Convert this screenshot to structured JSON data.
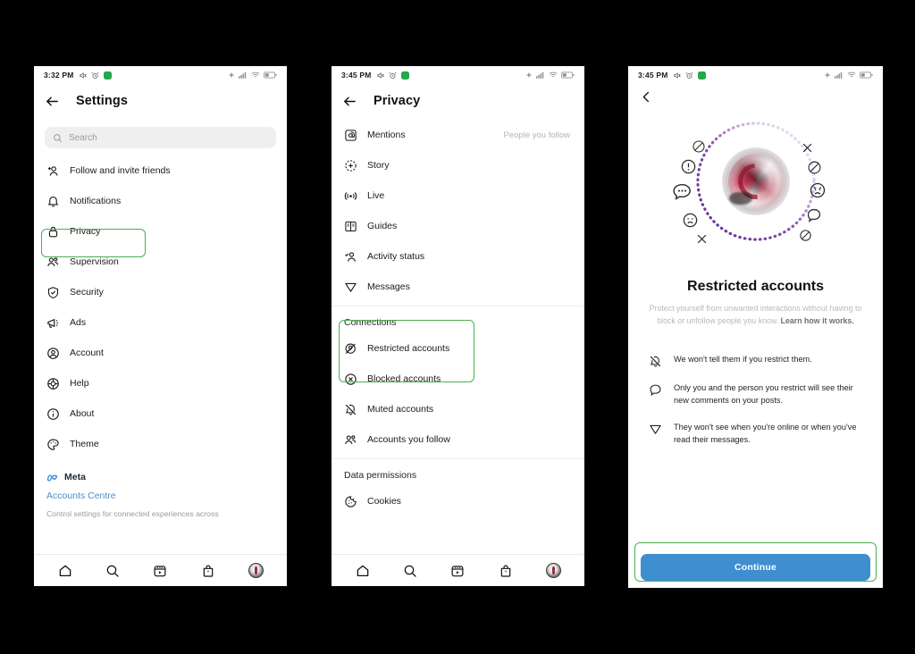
{
  "phones": [
    {
      "id": "settings",
      "status": {
        "time": "3:32 PM",
        "icons": [
          "mute-icon",
          "alarm-icon",
          "green-badge-icon",
          "location-icon",
          "signal-icon",
          "wifi-icon",
          "battery-icon"
        ]
      },
      "header": {
        "back": "back-arrow-icon",
        "title": "Settings"
      },
      "search": {
        "placeholder": "Search",
        "icon": "search-icon"
      },
      "items": [
        {
          "label": "Follow and invite friends",
          "icon": "add-person-icon"
        },
        {
          "label": "Notifications",
          "icon": "bell-icon"
        },
        {
          "label": "Privacy",
          "icon": "lock-icon",
          "highlighted": true
        },
        {
          "label": "Supervision",
          "icon": "people-icon"
        },
        {
          "label": "Security",
          "icon": "shield-check-icon"
        },
        {
          "label": "Ads",
          "icon": "megaphone-icon"
        },
        {
          "label": "Account",
          "icon": "account-circle-icon"
        },
        {
          "label": "Help",
          "icon": "lifebuoy-icon"
        },
        {
          "label": "About",
          "icon": "info-circle-icon"
        },
        {
          "label": "Theme",
          "icon": "palette-icon"
        }
      ],
      "meta": {
        "brand": "Meta",
        "brand_icon": "meta-infinity-icon",
        "link": "Accounts Centre",
        "description": "Control settings for connected experiences across"
      },
      "nav": [
        "home-icon",
        "search-icon",
        "reels-icon",
        "shop-icon",
        "profile-avatar"
      ]
    },
    {
      "id": "privacy",
      "status": {
        "time": "3:45 PM"
      },
      "header": {
        "back": "back-arrow-icon",
        "title": "Privacy"
      },
      "items": [
        {
          "label": "Mentions",
          "icon": "at-sign-icon",
          "value": "People you follow"
        },
        {
          "label": "Story",
          "icon": "story-plus-icon"
        },
        {
          "label": "Live",
          "icon": "live-broadcast-icon"
        },
        {
          "label": "Guides",
          "icon": "guides-book-icon"
        },
        {
          "label": "Activity status",
          "icon": "activity-person-icon"
        },
        {
          "label": "Messages",
          "icon": "paper-plane-icon"
        }
      ],
      "connections": {
        "section_title": "Connections",
        "highlighted": true,
        "items": [
          {
            "label": "Restricted accounts",
            "icon": "restricted-icon"
          },
          {
            "label": "Blocked accounts",
            "icon": "block-x-icon"
          },
          {
            "label": "Muted accounts",
            "icon": "bell-off-icon"
          },
          {
            "label": "Accounts you follow",
            "icon": "people-icon"
          }
        ]
      },
      "data_permissions": {
        "section_title": "Data permissions",
        "items": [
          {
            "label": "Cookies",
            "icon": "cookie-icon"
          }
        ]
      },
      "nav": [
        "home-icon",
        "search-icon",
        "reels-icon",
        "shop-icon",
        "profile-avatar"
      ]
    },
    {
      "id": "restricted",
      "status": {
        "time": "3:45 PM"
      },
      "header": {
        "back": "chevron-left-icon"
      },
      "hero": {
        "avatar": "profile-photo",
        "ring": "dotted-gradient-ring",
        "float_icons": [
          "block-icon",
          "warning-icon",
          "dots-bubble-icon",
          "sad-face-icon",
          "x-icon",
          "x-icon",
          "block-icon",
          "angry-face-icon",
          "speech-bubble-icon",
          "block-icon"
        ]
      },
      "title": "Restricted accounts",
      "subtitle_part1": "Protect yourself from unwanted interactions without having to block or unfollow people you know. ",
      "subtitle_bold": "Learn how it works.",
      "bullets": [
        {
          "icon": "bell-off-icon",
          "text": "We won't tell them if you restrict them."
        },
        {
          "icon": "speech-bubble-icon",
          "text": "Only you and the person you restrict will see their new comments on your posts."
        },
        {
          "icon": "paper-plane-icon",
          "text": "They won't see when you're online or when you've read their messages."
        }
      ],
      "cta": {
        "label": "Continue",
        "color": "#3e8ed0",
        "highlighted": true
      }
    }
  ],
  "colors": {
    "highlight": "#4caf50",
    "link": "#4a8ecb",
    "cta": "#3e8ed0",
    "muted": "#b4b4b4",
    "background": "#000000",
    "screen": "#ffffff"
  }
}
